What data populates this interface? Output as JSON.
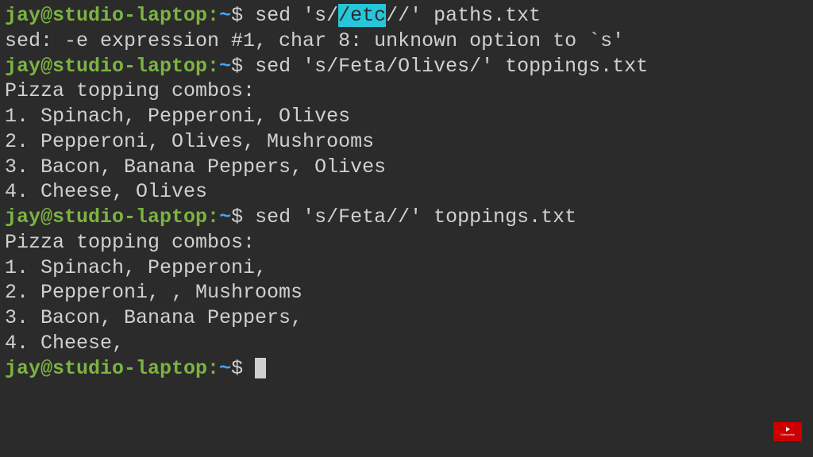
{
  "prompt": {
    "user": "jay@studio-laptop",
    "sep": ":",
    "path": "~",
    "dollar": "$"
  },
  "block1": {
    "cmd_pre": "sed 's/",
    "cmd_hl": "/etc",
    "cmd_post": "//' paths.txt",
    "output": "sed: -e expression #1, char 8: unknown option to `s'"
  },
  "block2": {
    "cmd": "sed 's/Feta/Olives/' toppings.txt",
    "out1": "Pizza topping combos:",
    "out2": "1. Spinach, Pepperoni, Olives",
    "out3": "2. Pepperoni, Olives, Mushrooms",
    "out4": "3. Bacon, Banana Peppers, Olives",
    "out5": "4. Cheese, Olives"
  },
  "block3": {
    "cmd": "sed 's/Feta//' toppings.txt",
    "out1": "Pizza topping combos:",
    "out2": "1. Spinach, Pepperoni,",
    "out3": "2. Pepperoni, , Mushrooms",
    "out4": "3. Bacon, Banana Peppers,",
    "out5": "4. Cheese,"
  },
  "subscribe": "Subscribe"
}
